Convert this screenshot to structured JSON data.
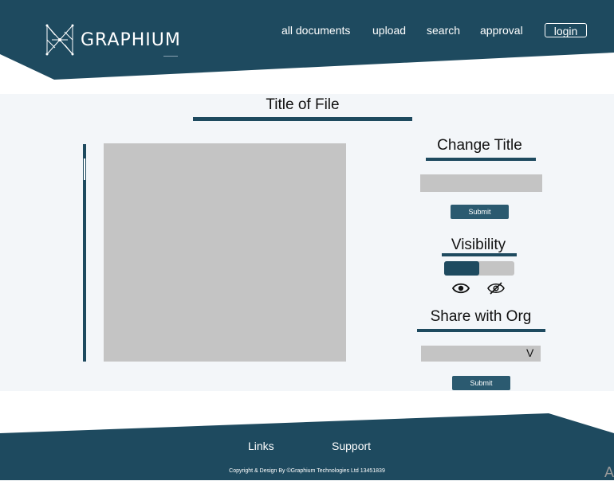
{
  "brand": {
    "name": "GRAPHIUM"
  },
  "nav": {
    "items": [
      "all documents",
      "upload",
      "search",
      "approval"
    ],
    "login_label": "login"
  },
  "document": {
    "title": "Title of File"
  },
  "change_title": {
    "heading": "Change Title",
    "input_value": "",
    "submit_label": "Submit"
  },
  "visibility": {
    "heading": "Visibility",
    "visible_fraction": 0.5
  },
  "share": {
    "heading": "Share with Org",
    "selected_value": "",
    "caret": "V",
    "submit_label": "Submit"
  },
  "footer": {
    "links": [
      "Links",
      "Support"
    ],
    "copyright": "Copyright & Design By ©Graphium Technologies Ltd 13451839"
  },
  "colors": {
    "primary": "#1e4a5f",
    "button": "#2b5a70",
    "placeholder_gray": "#c4c4c4",
    "main_bg": "#f3f6f9"
  },
  "corner_glyph": "A"
}
